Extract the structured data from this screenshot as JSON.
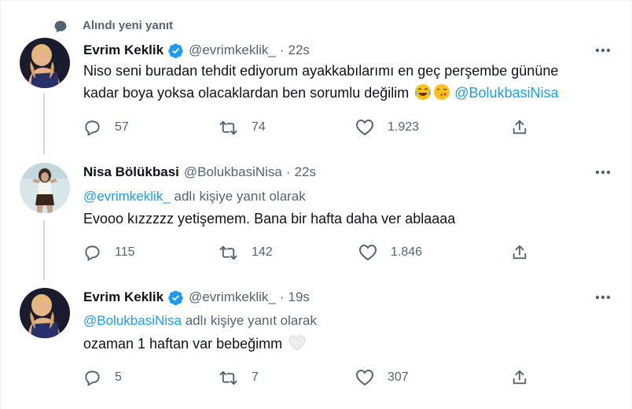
{
  "social_context": {
    "label": "Alındı yeni yanıt",
    "icon": "speech-bubble-icon"
  },
  "colors": {
    "accent": "#1d9bf0",
    "muted": "#536471",
    "text": "#0f1419",
    "thread_line": "#cfd9de"
  },
  "tweets": [
    {
      "name": "Evrim Keklik",
      "verified": true,
      "handle": "@evrimkeklik_",
      "separator": "·",
      "time": "22s",
      "reply_mention": "",
      "reply_suffix": "",
      "text_line1": "Niso seni buradan tehdit ediyorum ayakkabılarımı en geç perşembe gününe",
      "text_line2": "kadar boya yoksa olacaklardan ben sorumlu değilim",
      "emojis": [
        "face-with-tears-of-joy",
        "face-blowing-kiss"
      ],
      "mention": "@BolukbasiNisa",
      "replies": "57",
      "retweets": "74",
      "likes": "1.923"
    },
    {
      "name": "Nisa Bölükbasi",
      "verified": false,
      "handle": "@BolukbasiNisa",
      "separator": "·",
      "time": "22s",
      "reply_mention": "@evrimkeklik_",
      "reply_suffix": "adlı kişiye yanıt olarak",
      "text_line1": "Evooo kızzzzz yetişemem. Bana bir hafta daha ver ablaaaa",
      "replies": "115",
      "retweets": "142",
      "likes": "1.846"
    },
    {
      "name": "Evrim Keklik",
      "verified": true,
      "handle": "@evrimkeklik_",
      "separator": "·",
      "time": "19s",
      "reply_mention": "@BolukbasiNisa",
      "reply_suffix": "adlı kişiye yanıt olarak",
      "text_line1": "ozaman 1 haftan var bebeğimm",
      "emojis": [
        "white-heart"
      ],
      "replies": "5",
      "retweets": "7",
      "likes": "307"
    }
  ]
}
